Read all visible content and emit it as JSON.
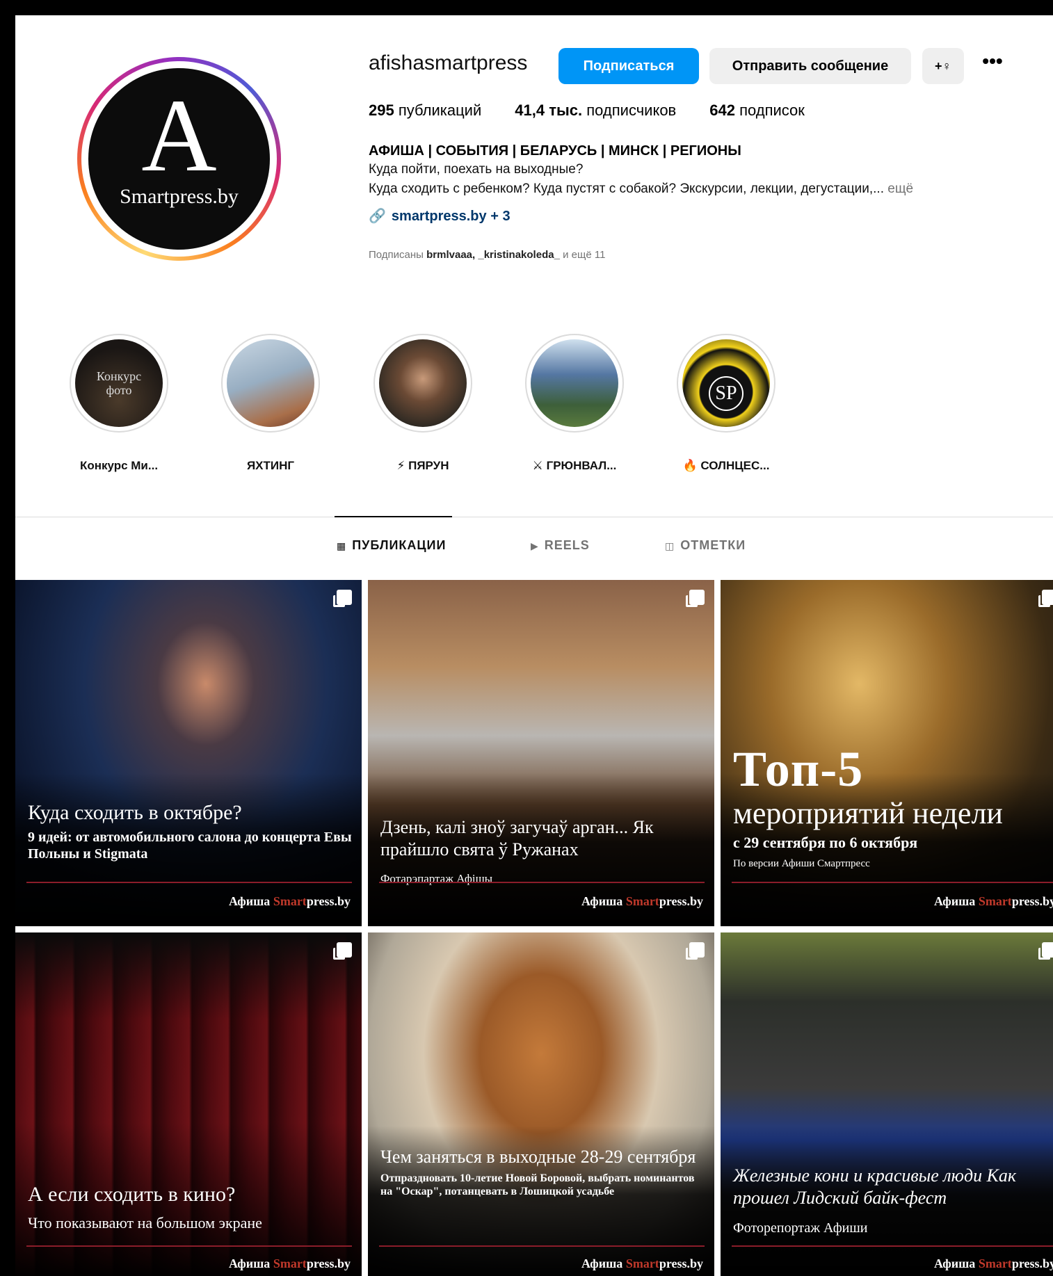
{
  "profile": {
    "username": "afishasmartpress",
    "avatar_letter": "A",
    "avatar_text": "Smartpress.by",
    "follow_label": "Подписаться",
    "message_label": "Отправить сообщение",
    "suggest_icon": "+♀",
    "more_icon": "•••",
    "stats": {
      "posts_num": "295",
      "posts_label": "публикаций",
      "followers_num": "41,4 тыс.",
      "followers_label": "подписчиков",
      "following_num": "642",
      "following_label": "подписок"
    },
    "bio": {
      "title": "АФИША | СОБЫТИЯ | БЕЛАРУСЬ | МИНСК | РЕГИОНЫ",
      "line1": "Куда пойти, поехать на выходные?",
      "line2": "Куда сходить с ребенком? Куда пустят с собакой? Экскурсии, лекции, дегустации,...",
      "more": "ещё",
      "link_icon": "🔗",
      "link": "smartpress.by + 3"
    },
    "followed_by": {
      "prefix": "Подписаны",
      "users": "brmlvaaa, _kristinakoleda_",
      "suffix": "и ещё 11"
    }
  },
  "highlights": [
    {
      "label": "Конкурс Ми...",
      "cover_text": "Конкурс фото",
      "color": "#2b2420"
    },
    {
      "label": "ЯХТИНГ",
      "color": "#9aa9b8"
    },
    {
      "label": "⚡ ПЯРУН",
      "color": "#3b352c"
    },
    {
      "label": "⚔ ГРЮНВАЛ...",
      "color": "#4e6f93"
    },
    {
      "label": "🔥 СОЛНЦЕС...",
      "cover_text": "SP",
      "color": "#111111"
    }
  ],
  "tabs": [
    {
      "icon": "▦",
      "label": "ПУБЛИКАЦИИ",
      "active": true
    },
    {
      "icon": "▶",
      "label": "REELS",
      "active": false
    },
    {
      "icon": "◫",
      "label": "ОТМЕТКИ",
      "active": false
    }
  ],
  "posts": [
    {
      "title": "Куда сходить в октябре?",
      "sub": "9 идей: от автомобильного салона до концерта Евы Польны и Stigmata",
      "brand_a": "Афиша ",
      "brand_b": "Smart",
      "brand_c": "press.by"
    },
    {
      "title": "Дзень, калі зноў загучаў арган... Як прайшло свята ў Ружанах",
      "note": "Фотарэпартаж Афішы",
      "brand_a": "Афиша ",
      "brand_b": "Smart",
      "brand_c": "press.by"
    },
    {
      "top": "Топ-5",
      "title": "мероприятий недели",
      "sub": "с 29 сентября по 6 октября",
      "note": "По версии Афиши Смартпресс",
      "brand_a": "Афиша ",
      "brand_b": "Smart",
      "brand_c": "press.by"
    },
    {
      "title": "А если сходить в кино?",
      "sub": "Что показывают на большом экране",
      "brand_a": "Афиша ",
      "brand_b": "Smart",
      "brand_c": "press.by"
    },
    {
      "title": "Чем заняться в выходные 28-29 сентября",
      "sub": "Отпраздновать 10-летие Новой Боровой, выбрать номинантов на \"Оскар\", потанцевать в Лошицкой усадьбе",
      "brand_a": "Афиша ",
      "brand_b": "Smart",
      "brand_c": "press.by"
    },
    {
      "title": "Железные кони и красивые люди Как прошел Лидский байк-фест",
      "note": "Фоторепортаж Афиши",
      "brand_a": "Афиша ",
      "brand_b": "Smart",
      "brand_c": "press.by"
    }
  ]
}
